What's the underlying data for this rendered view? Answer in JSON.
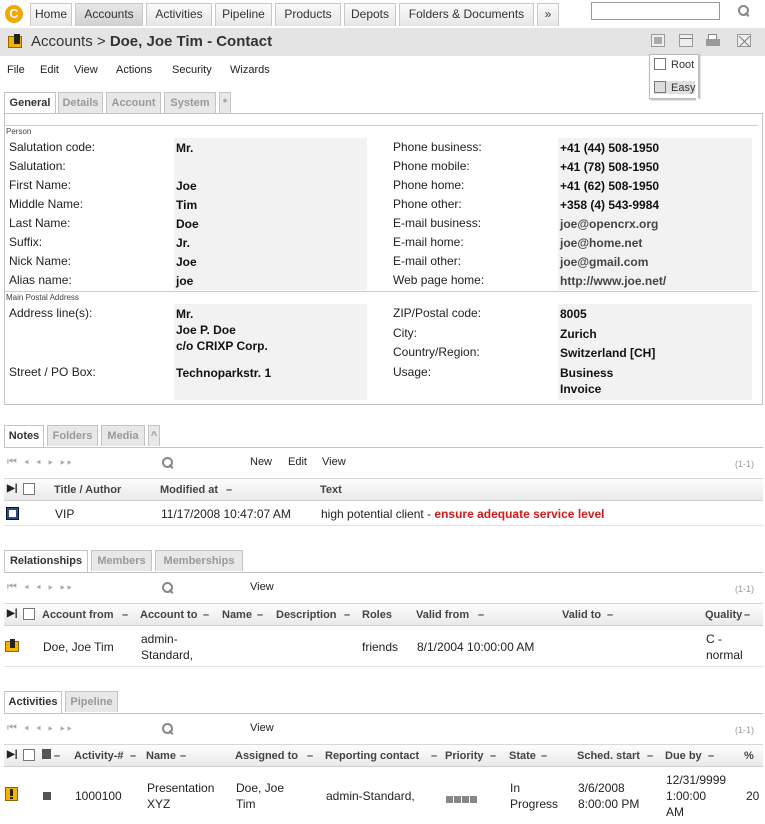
{
  "nav": {
    "tabs": [
      "Home",
      "Accounts",
      "Activities",
      "Pipeline",
      "Products",
      "Depots",
      "Folders & Documents",
      "»"
    ],
    "active": "Accounts",
    "search_value": ""
  },
  "title": {
    "prefix": "Accounts >",
    "name": "Doe, Joe Tim - Contact"
  },
  "menus": [
    "File",
    "Edit",
    "View",
    "Actions",
    "Security",
    "Wizards"
  ],
  "view_popup": {
    "options": [
      "Root",
      "Easy"
    ],
    "selected": "Easy"
  },
  "form_tabs": [
    "General",
    "Details",
    "Account",
    "System",
    "*"
  ],
  "sections": {
    "person": "Person",
    "address": "Main Postal Address"
  },
  "person_left": [
    {
      "label": "Salutation code:",
      "value": "Mr."
    },
    {
      "label": "Salutation:",
      "value": ""
    },
    {
      "label": "First Name:",
      "value": "Joe"
    },
    {
      "label": "Middle Name:",
      "value": "Tim"
    },
    {
      "label": "Last Name:",
      "value": "Doe"
    },
    {
      "label": "Suffix:",
      "value": "Jr."
    },
    {
      "label": "Nick Name:",
      "value": "Joe"
    },
    {
      "label": "Alias name:",
      "value": "joe"
    }
  ],
  "person_right": [
    {
      "label": "Phone business:",
      "value": "+41 (44) 508-1950"
    },
    {
      "label": "Phone mobile:",
      "value": "+41 (78) 508-1950"
    },
    {
      "label": "Phone home:",
      "value": "+41 (62) 508-1950"
    },
    {
      "label": "Phone other:",
      "value": "+358 (4) 543-9984"
    },
    {
      "label": "E-mail business:",
      "value": "joe@opencrx.org"
    },
    {
      "label": "E-mail home:",
      "value": "joe@home.net"
    },
    {
      "label": "E-mail other:",
      "value": "joe@gmail.com"
    },
    {
      "label": "Web page home:",
      "value": "http://www.joe.net/"
    }
  ],
  "address": {
    "address_line_label": "Address line(s):",
    "address_lines": [
      "Mr.",
      "Joe P. Doe",
      "c/o CRIXP Corp."
    ],
    "street_label": "Street / PO Box:",
    "street": "Technoparkstr. 1",
    "zip_label": "ZIP/Postal code:",
    "zip": "8005",
    "city_label": "City:",
    "city": "Zurich",
    "country_label": "Country/Region:",
    "country": "Switzerland [CH]",
    "usage_label": "Usage:",
    "usage": [
      "Business",
      "Invoice"
    ]
  },
  "notes": {
    "tabs": [
      "Notes",
      "Folders",
      "Media",
      "^"
    ],
    "actions": [
      "New",
      "Edit",
      "View"
    ],
    "count": "(1-1)",
    "columns": [
      "Title / Author",
      "Modified at",
      "Text"
    ],
    "rows": [
      {
        "title": "VIP",
        "modified": "11/17/2008 10:47:07 AM",
        "text_plain": "high potential client - ",
        "text_highlight": "ensure adequate service level"
      }
    ]
  },
  "relationships": {
    "tabs": [
      "Relationships",
      "Members",
      "Memberships"
    ],
    "actions": [
      "View"
    ],
    "count": "(1-1)",
    "columns": [
      "Account from",
      "Account to",
      "Name",
      "Description",
      "Roles",
      "Valid from",
      "Valid to",
      "Quality"
    ],
    "rows": [
      {
        "from": "Doe, Joe Tim",
        "to": [
          "admin-",
          "Standard,"
        ],
        "name": "",
        "description": "",
        "roles": "friends",
        "valid_from": "8/1/2004 10:00:00 AM",
        "valid_to": "",
        "quality": [
          "C -",
          "normal"
        ]
      }
    ]
  },
  "activities": {
    "tabs": [
      "Activities",
      "Pipeline"
    ],
    "actions": [
      "View"
    ],
    "count": "(1-1)",
    "columns": [
      "Activity-#",
      "Name",
      "Assigned to",
      "Reporting contact",
      "Priority",
      "State",
      "Sched. start",
      "Due by",
      "%"
    ],
    "rows": [
      {
        "number": "1000100",
        "name": [
          "Presentation",
          "XYZ"
        ],
        "assigned": [
          "Doe, Joe",
          "Tim"
        ],
        "reporting": "admin-Standard,",
        "priority_level": 4,
        "state": [
          "In",
          "Progress"
        ],
        "sched_start": [
          "3/6/2008",
          "8:00:00 PM"
        ],
        "due_by": [
          "12/31/9999",
          "1:00:00",
          "AM"
        ],
        "percent": "20"
      }
    ]
  },
  "colors": {
    "highlight_red": "#d41a1a",
    "logo_orange": "#f2a800",
    "title_bar": "#e4e4e4"
  }
}
